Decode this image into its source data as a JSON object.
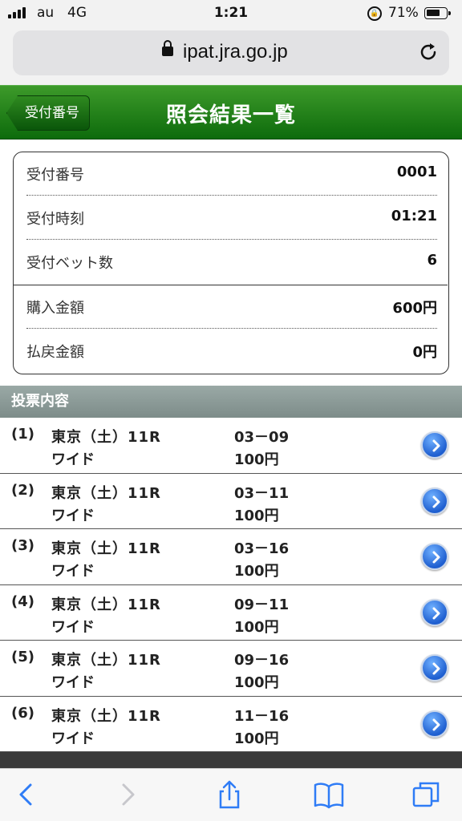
{
  "status_bar": {
    "carrier": "au",
    "network": "4G",
    "time": "1:21",
    "battery_percent": "71%",
    "battery_level": 0.71
  },
  "browser": {
    "url": "ipat.jra.go.jp"
  },
  "header": {
    "back_label": "受付番号",
    "title": "照会結果一覧"
  },
  "summary": {
    "rows": [
      {
        "label": "受付番号",
        "value": "0001"
      },
      {
        "label": "受付時刻",
        "value": "01:21"
      },
      {
        "label": "受付ベット数",
        "value": "6"
      },
      {
        "label": "購入金額",
        "value": "600円"
      },
      {
        "label": "払戻金額",
        "value": "0円"
      }
    ]
  },
  "section": {
    "title": "投票内容"
  },
  "bets": [
    {
      "index": "(1)",
      "race": "東京（土）11R",
      "bet_type": "ワイド",
      "combination": "03－09",
      "amount": "100円"
    },
    {
      "index": "(2)",
      "race": "東京（土）11R",
      "bet_type": "ワイド",
      "combination": "03－11",
      "amount": "100円"
    },
    {
      "index": "(3)",
      "race": "東京（土）11R",
      "bet_type": "ワイド",
      "combination": "03－16",
      "amount": "100円"
    },
    {
      "index": "(4)",
      "race": "東京（土）11R",
      "bet_type": "ワイド",
      "combination": "09－11",
      "amount": "100円"
    },
    {
      "index": "(5)",
      "race": "東京（土）11R",
      "bet_type": "ワイド",
      "combination": "09－16",
      "amount": "100円"
    },
    {
      "index": "(6)",
      "race": "東京（土）11R",
      "bet_type": "ワイド",
      "combination": "11－16",
      "amount": "100円"
    }
  ],
  "colors": {
    "header_green": "#0d6b0c",
    "section_gray": "#8a9996",
    "ios_blue": "#2f7cf6"
  }
}
